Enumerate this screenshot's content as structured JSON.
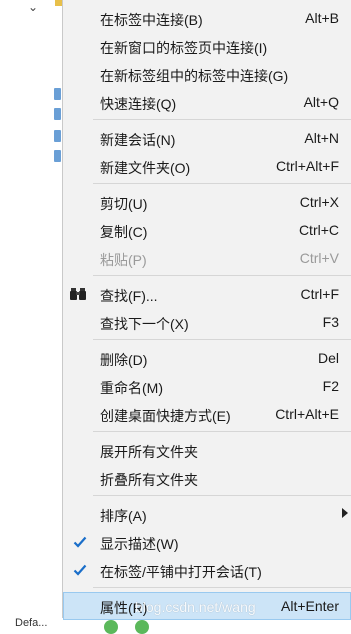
{
  "menu": {
    "items": [
      {
        "label": "在标签中连接(B)",
        "shortcut": "Alt+B"
      },
      {
        "label": "在新窗口的标签页中连接(I)",
        "shortcut": ""
      },
      {
        "label": "在新标签组中的标签中连接(G)",
        "shortcut": ""
      },
      {
        "label": "快速连接(Q)",
        "shortcut": "Alt+Q"
      },
      {
        "label": "新建会话(N)",
        "shortcut": "Alt+N"
      },
      {
        "label": "新建文件夹(O)",
        "shortcut": "Ctrl+Alt+F"
      },
      {
        "label": "剪切(U)",
        "shortcut": "Ctrl+X"
      },
      {
        "label": "复制(C)",
        "shortcut": "Ctrl+C"
      },
      {
        "label": "粘贴(P)",
        "shortcut": "Ctrl+V"
      },
      {
        "label": "查找(F)...",
        "shortcut": "Ctrl+F"
      },
      {
        "label": "查找下一个(X)",
        "shortcut": "F3"
      },
      {
        "label": "删除(D)",
        "shortcut": "Del"
      },
      {
        "label": "重命名(M)",
        "shortcut": "F2"
      },
      {
        "label": "创建桌面快捷方式(E)",
        "shortcut": "Ctrl+Alt+E"
      },
      {
        "label": "展开所有文件夹",
        "shortcut": ""
      },
      {
        "label": "折叠所有文件夹",
        "shortcut": ""
      },
      {
        "label": "排序(A)",
        "shortcut": ""
      },
      {
        "label": "显示描述(W)",
        "shortcut": ""
      },
      {
        "label": "在标签/平铺中打开会话(T)",
        "shortcut": ""
      },
      {
        "label": "属性(R)",
        "shortcut": "Alt+Enter"
      }
    ]
  },
  "background": {
    "bottom_text": "Defa..."
  },
  "watermark": "blog.csdn.net/wang"
}
